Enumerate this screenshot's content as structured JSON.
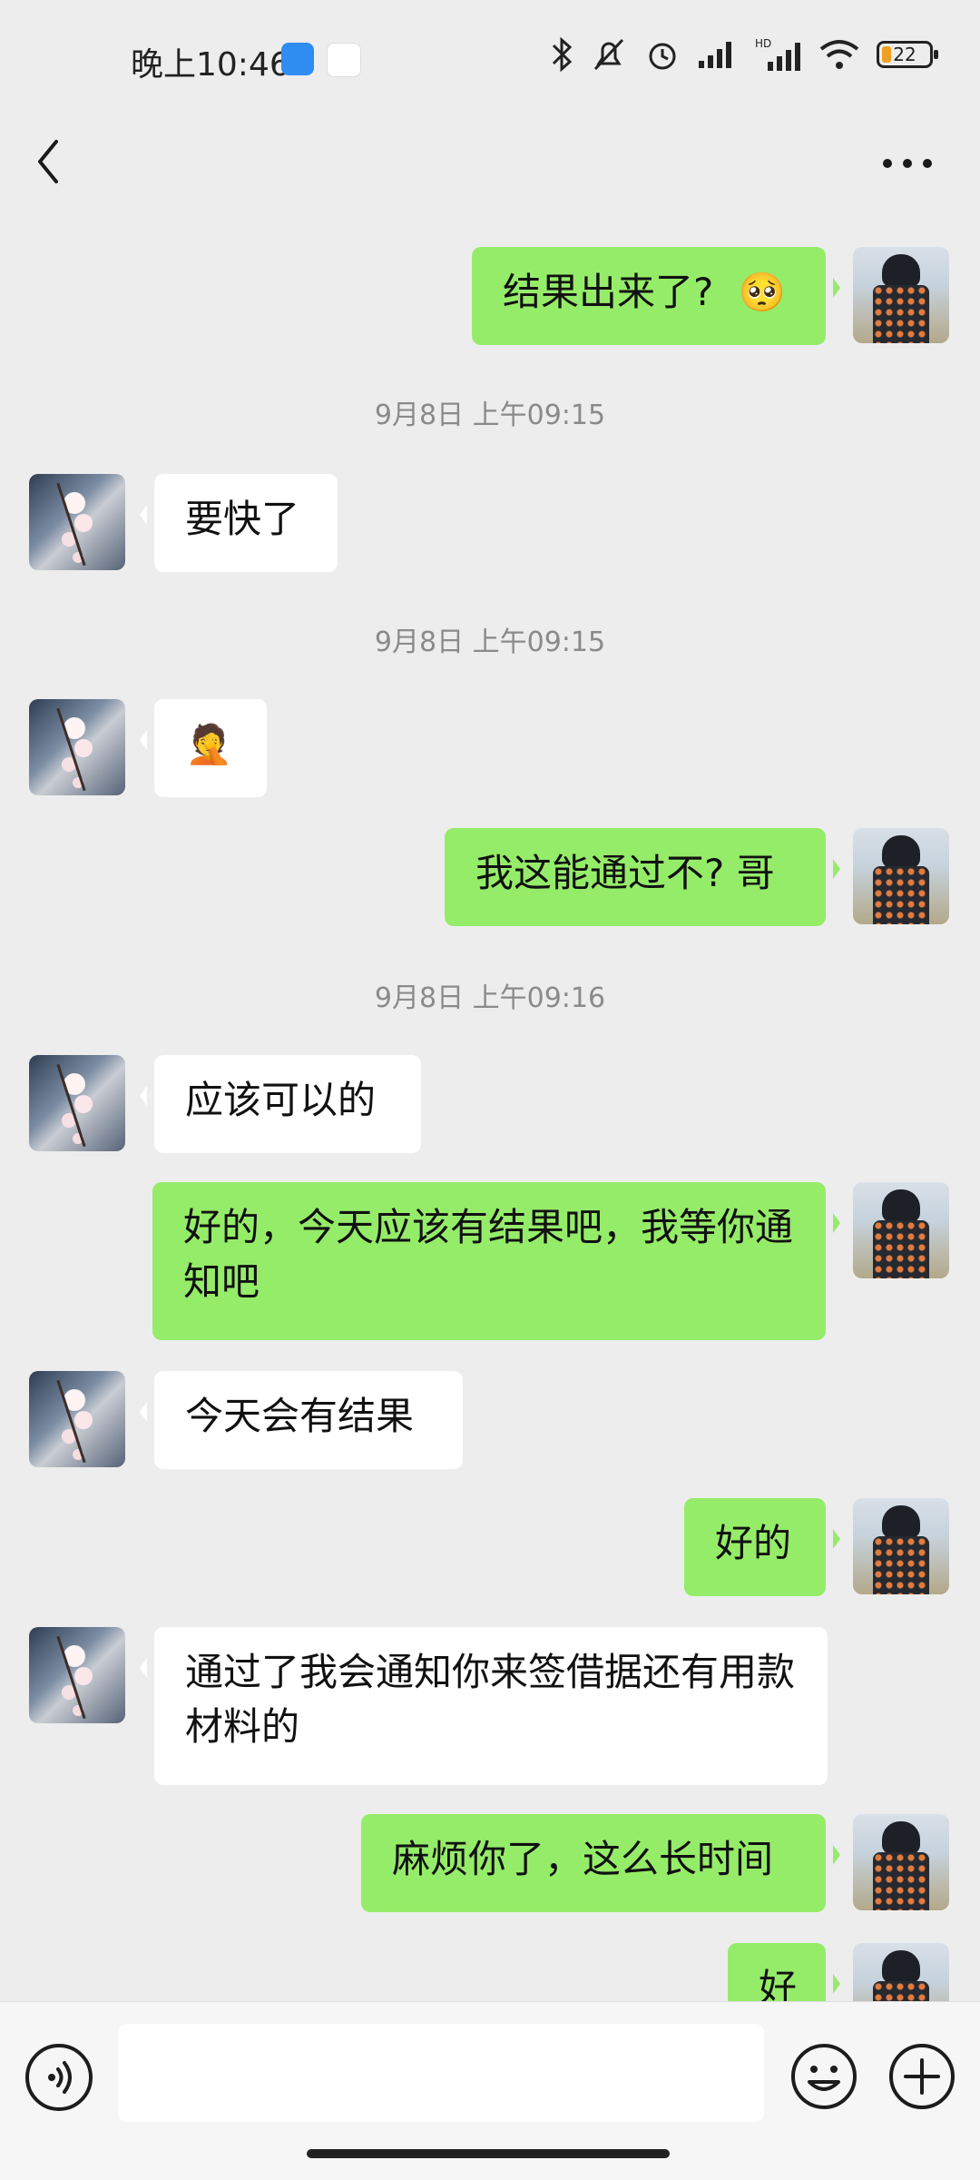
{
  "status_bar": {
    "time": "晚上10:46",
    "battery": "22"
  },
  "chat": {
    "messages": [
      {
        "side": "out",
        "text": "结果出来了?",
        "emoji": "🥺"
      },
      {
        "type": "timestamp",
        "text": "9月8日 上午09:15"
      },
      {
        "side": "in",
        "text": "要快了"
      },
      {
        "type": "timestamp",
        "text": "9月8日 上午09:15"
      },
      {
        "side": "in",
        "emoji": "🤦"
      },
      {
        "side": "out",
        "text": "我这能通过不? 哥"
      },
      {
        "type": "timestamp",
        "text": "9月8日 上午09:16"
      },
      {
        "side": "in",
        "text": "应该可以的"
      },
      {
        "side": "out",
        "text": "好的，今天应该有结果吧，我等你通知吧"
      },
      {
        "side": "in",
        "text": "今天会有结果"
      },
      {
        "side": "out",
        "text": "好的"
      },
      {
        "side": "in",
        "text": "通过了我会通知你来签借据还有用款材料的"
      },
      {
        "side": "out",
        "text": "麻烦你了，这么长时间"
      },
      {
        "side": "out",
        "text": "好"
      }
    ]
  },
  "icons": {
    "back": "chevron-left-icon",
    "more": "more-dots-icon",
    "voice": "voice-icon",
    "emoji": "smiley-icon",
    "plus": "plus-circle-icon"
  },
  "colors": {
    "background": "#ededed",
    "outgoing_bubble": "#95ec69",
    "incoming_bubble": "#ffffff"
  }
}
